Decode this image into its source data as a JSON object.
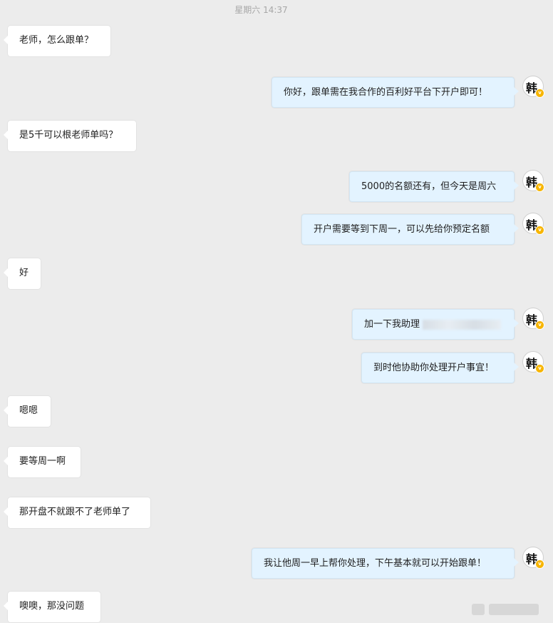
{
  "header": {
    "timestamp": "星期六 14:37"
  },
  "messages": [
    {
      "side": "left",
      "text": "老师，怎么跟单？"
    },
    {
      "side": "right",
      "text": "你好，跟单需在我合作的百利好平台下开户即可！",
      "avatar": "韩"
    },
    {
      "side": "left",
      "text": "是5千可以根老师单吗？"
    },
    {
      "side": "right",
      "text": "5000的名额还有，但今天是周六",
      "avatar": "韩"
    },
    {
      "side": "right",
      "text": "开户需要等到下周一，可以先给你预定名额",
      "avatar": "韩"
    },
    {
      "side": "left",
      "text": "好"
    },
    {
      "side": "right",
      "text": "加一下我助理",
      "redacted": true,
      "avatar": "韩"
    },
    {
      "side": "right",
      "text": "到时他协助你处理开户事宜！",
      "avatar": "韩"
    },
    {
      "side": "left",
      "text": "嗯嗯"
    },
    {
      "side": "left",
      "text": "要等周一啊"
    },
    {
      "side": "left",
      "text": "那开盘不就跟不了老师单了"
    },
    {
      "side": "right",
      "text": "我让他周一早上帮你处理，下午基本就可以开始跟单！",
      "avatar": "韩"
    },
    {
      "side": "left",
      "text": "噢噢，那没问题"
    }
  ],
  "colors": {
    "background": "#ececec",
    "incoming_bubble": "#ffffff",
    "outgoing_bubble": "#e3f3ff",
    "verified_badge": "#f7b500"
  },
  "icons": {
    "avatar": "avatar-han-calligraphy",
    "badge": "verified-badge-icon"
  }
}
